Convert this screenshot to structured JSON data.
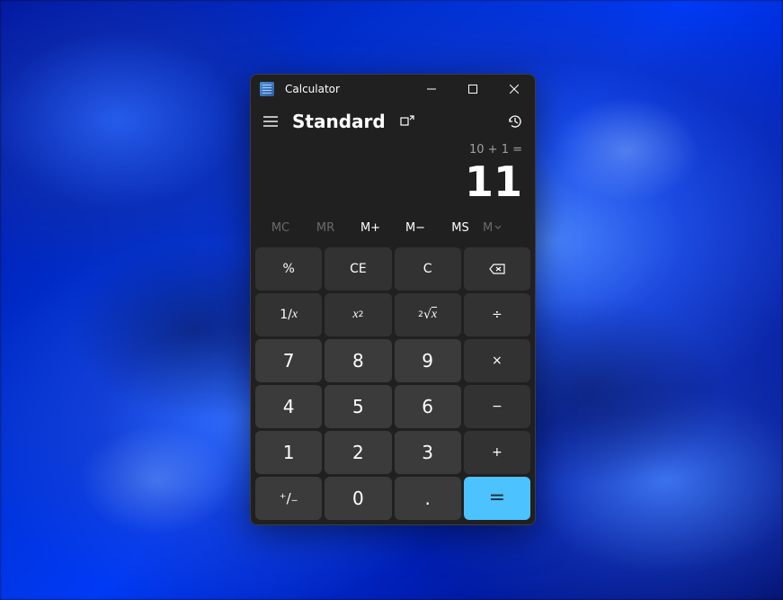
{
  "window": {
    "title": "Calculator"
  },
  "mode": {
    "label": "Standard"
  },
  "display": {
    "expression": "10 + 1 =",
    "result": "11"
  },
  "memory": {
    "mc": "MC",
    "mr": "MR",
    "mplus": "M+",
    "mminus": "M−",
    "ms": "MS",
    "mdd": "M"
  },
  "keys": {
    "percent": "%",
    "ce": "CE",
    "c": "C",
    "reciprocal_pre": "1/",
    "reciprocal_var": "x",
    "square_var": "x",
    "square_exp": "2",
    "sqrt_exp": "2",
    "sqrt_rad": "√",
    "sqrt_var": "x",
    "divide": "÷",
    "multiply": "×",
    "minus": "−",
    "plus": "+",
    "equals": "=",
    "negate": "⁺/₋",
    "decimal": ".",
    "d0": "0",
    "d1": "1",
    "d2": "2",
    "d3": "3",
    "d4": "4",
    "d5": "5",
    "d6": "6",
    "d7": "7",
    "d8": "8",
    "d9": "9"
  }
}
